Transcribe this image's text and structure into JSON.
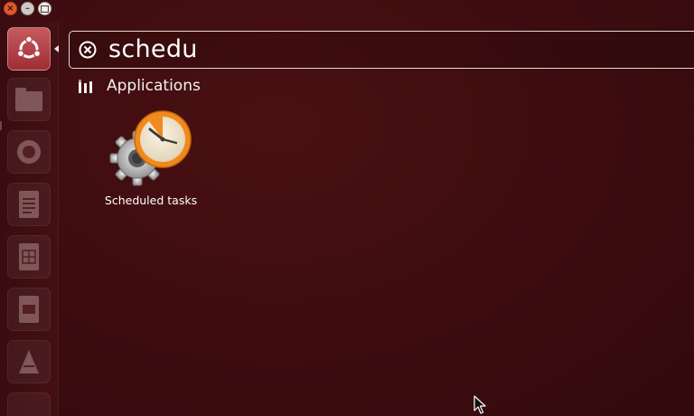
{
  "search": {
    "value": "schedu"
  },
  "category": {
    "label": "Applications",
    "icon": "applications-icon"
  },
  "results": [
    {
      "label": "Scheduled tasks",
      "icon": "scheduled-tasks-icon"
    }
  ],
  "launcher": {
    "items": [
      "dash-home-icon",
      "files-icon",
      "browser-icon",
      "document-icon",
      "spreadsheet-icon",
      "presentation-icon",
      "software-center-icon"
    ]
  },
  "colors": {
    "background": "#3f0d10",
    "dash_accent": "#b9444b",
    "close": "#e05a2b",
    "clock_orange": "#f08a1c"
  }
}
